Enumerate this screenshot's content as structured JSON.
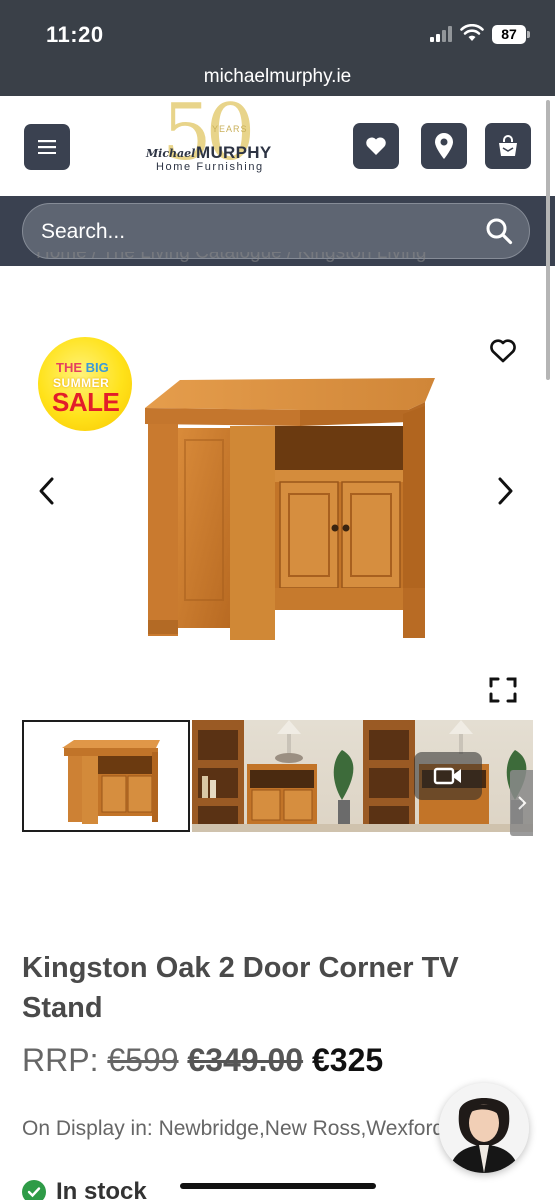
{
  "status_bar": {
    "time": "11:20",
    "battery": "87"
  },
  "browser": {
    "url": "michaelmurphy.ie"
  },
  "header": {
    "logo": {
      "years": "50",
      "years_label": "YEARS",
      "first_name": "Michael",
      "last_name": "MURPHY",
      "subtitle": "Home Furnishing"
    },
    "icons": [
      "menu-icon",
      "heart-icon",
      "location-pin-icon",
      "shopping-bag-icon"
    ]
  },
  "search": {
    "placeholder": "Search..."
  },
  "breadcrumb": {
    "text": "Home / The Living Catalogue / Kingston Living"
  },
  "gallery": {
    "badge": {
      "the": "THE",
      "big": "BIG",
      "summer": "SUMMER",
      "sale": "SALE"
    },
    "thumbnail_count": 3
  },
  "product": {
    "title": "Kingston Oak 2 Door Corner TV Stand",
    "rrp_label": "RRP:",
    "rrp_price": "€599",
    "was_price": "€349.00",
    "now_price": "€325",
    "display_label": "On Display in:",
    "display_locations": "Newbridge,New Ross,Wexford",
    "stock_status": "In stock"
  },
  "colors": {
    "brand_dark": "#3a4150",
    "sale_red": "#e21d2a",
    "in_stock_green": "#2e9b47"
  }
}
